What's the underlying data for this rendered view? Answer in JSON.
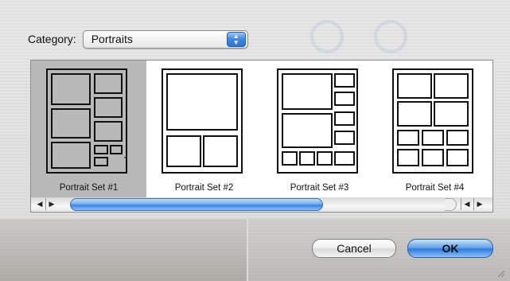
{
  "category": {
    "label": "Category:",
    "selected": "Portraits"
  },
  "gallery": {
    "items": [
      {
        "label": "Portrait Set #1",
        "selected": true
      },
      {
        "label": "Portrait Set #2",
        "selected": false
      },
      {
        "label": "Portrait Set #3",
        "selected": false
      },
      {
        "label": "Portrait Set #4",
        "selected": false
      }
    ]
  },
  "scrollbar": {
    "left_arrow": "◀",
    "right_arrow": "▶"
  },
  "buttons": {
    "cancel": "Cancel",
    "ok": "OK"
  },
  "colors": {
    "selection": "#b9b9b9",
    "accent": "#3b84e2"
  }
}
